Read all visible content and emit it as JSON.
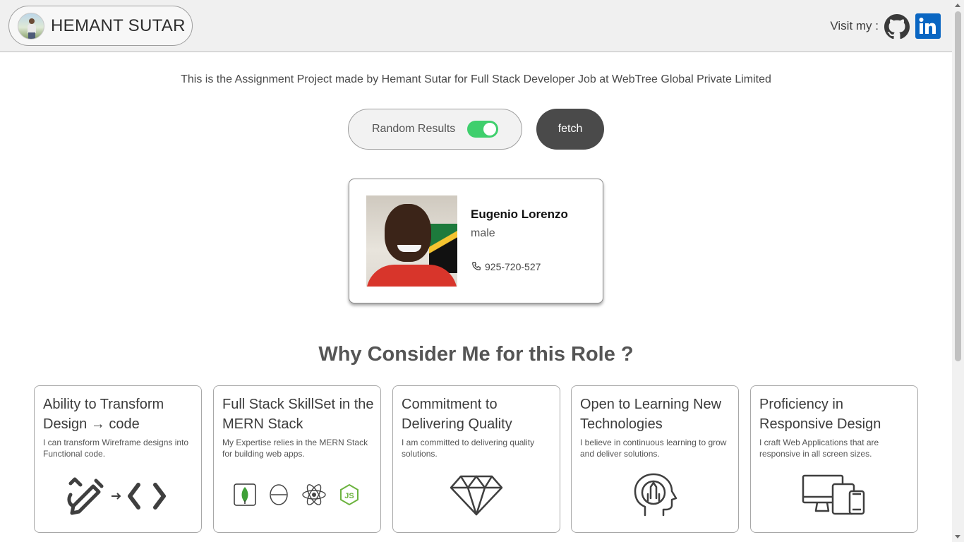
{
  "header": {
    "brand_name": "HEMANT SUTAR",
    "visit_label": "Visit my :",
    "links": [
      {
        "name": "github",
        "icon": "github-icon"
      },
      {
        "name": "linkedin",
        "icon": "linkedin-icon",
        "text": "in"
      }
    ]
  },
  "tagline": "This is the Assignment Project made by Hemant Sutar for Full Stack Developer Job at WebTree Global Private Limited",
  "controls": {
    "toggle_label": "Random Results",
    "toggle_on": true,
    "fetch_label": "fetch"
  },
  "user_card": {
    "name": "Eugenio Lorenzo",
    "gender": "male",
    "phone": "925-720-527"
  },
  "section_title": "Why Consider Me for this Role ?",
  "features": [
    {
      "title": "Ability to Transform Design → code",
      "desc": "I can transform Wireframe designs into Functional code.",
      "icon": "design-to-code-icon"
    },
    {
      "title": "Full Stack SkillSet in the MERN Stack",
      "desc": "My Expertise relies in the MERN Stack for building web apps.",
      "icon": "mern-stack-icons"
    },
    {
      "title": "Commitment to Delivering Quality",
      "desc": "I am committed to delivering quality solutions.",
      "icon": "diamond-icon"
    },
    {
      "title": "Open to Learning New Technologies",
      "desc": "I believe in continuous learning to grow and deliver solutions.",
      "icon": "learning-head-icon"
    },
    {
      "title": "Proficiency in Responsive Design",
      "desc": "I craft Web Applications that are responsive in all screen sizes.",
      "icon": "responsive-devices-icon"
    }
  ],
  "colors": {
    "header_bg": "#f0f0f0",
    "toggle_on": "#3fcf6d",
    "fetch_bg": "#4a4a4a",
    "linkedin": "#0a66c2"
  }
}
